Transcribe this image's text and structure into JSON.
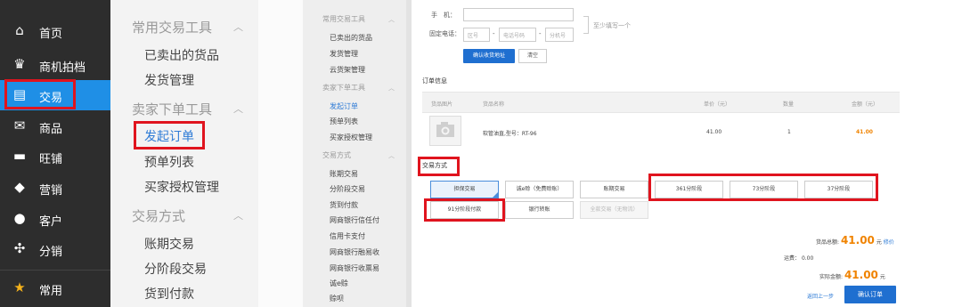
{
  "colors": {
    "nav_bg": "#2d2d2d",
    "nav_active": "#1f8fe6",
    "highlight": "#e0141e",
    "link": "#2e7bd6",
    "amount": "#f08300",
    "primary_btn": "#1f6fd0"
  },
  "nav": {
    "items": [
      {
        "icon": "home-icon",
        "label": "首页"
      },
      {
        "icon": "crown-icon",
        "label": "商机拍档"
      },
      {
        "icon": "clipboard-icon",
        "label": "交易"
      },
      {
        "icon": "mail-icon",
        "label": "商品"
      },
      {
        "icon": "store-icon",
        "label": "旺铺"
      },
      {
        "icon": "tag-icon",
        "label": "营销"
      },
      {
        "icon": "user-icon",
        "label": "客户"
      },
      {
        "icon": "share-icon",
        "label": "分销"
      },
      {
        "icon": "star-icon",
        "label": "常用"
      }
    ]
  },
  "panel2": {
    "group1": {
      "title": "常用交易工具",
      "items": [
        "已卖出的货品",
        "发货管理"
      ]
    },
    "group2": {
      "title": "卖家下单工具",
      "items": [
        "发起订单",
        "预单列表",
        "买家授权管理"
      ]
    },
    "group3": {
      "title": "交易方式",
      "items": [
        "账期交易",
        "分阶段交易",
        "货到付款"
      ]
    }
  },
  "panel3": {
    "group1": {
      "title": "常用交易工具",
      "items": [
        "已卖出的货品",
        "发货管理",
        "云货架管理"
      ]
    },
    "group2": {
      "title": "卖家下单工具",
      "items": [
        "发起订单",
        "预单列表",
        "买家授权管理"
      ]
    },
    "group3": {
      "title": "交易方式",
      "items": [
        "账期交易",
        "分阶段交易",
        "货到付款",
        "网商银行信任付",
        "信用卡支付",
        "网商银行融易收",
        "网商银行收票易",
        "诚e赊",
        "赊呗"
      ]
    }
  },
  "contact": {
    "mobile_label": "手　机：",
    "phone_label": "固定电话：",
    "area_code_placeholder": "区号",
    "phone_placeholder": "电话号码",
    "ext_placeholder": "分机号",
    "hint": "至少填写一个",
    "confirm_address": "确认收货地址",
    "clear": "清空"
  },
  "order": {
    "section_title": "订单信息",
    "headers": [
      "货品图片",
      "货品名称",
      "单价（元）",
      "数量",
      "金额（元）"
    ],
    "row": {
      "name": "软管油直,型号：RT-96",
      "price": "41.00",
      "qty": "1",
      "amount": "41.00"
    }
  },
  "payment": {
    "title": "交易方式",
    "methods_row1": [
      "担保交易",
      "诚e赊（免费赊账）",
      "账期交易",
      "361分阶段",
      "73分阶段",
      "37分阶段"
    ],
    "methods_row2": [
      "91分阶段付款",
      "银行转账",
      "全款交易（无物流）"
    ]
  },
  "summary": {
    "total_label": "货品总额:",
    "total_value": "41.00",
    "total_unit": "元",
    "modify": "修价",
    "shipping_label": "运费：",
    "shipping_value": "0.00",
    "pay_label": "实际金额:",
    "pay_value": "41.00",
    "pay_unit": "元",
    "back": "返回上一步",
    "confirm": "确认订单"
  }
}
